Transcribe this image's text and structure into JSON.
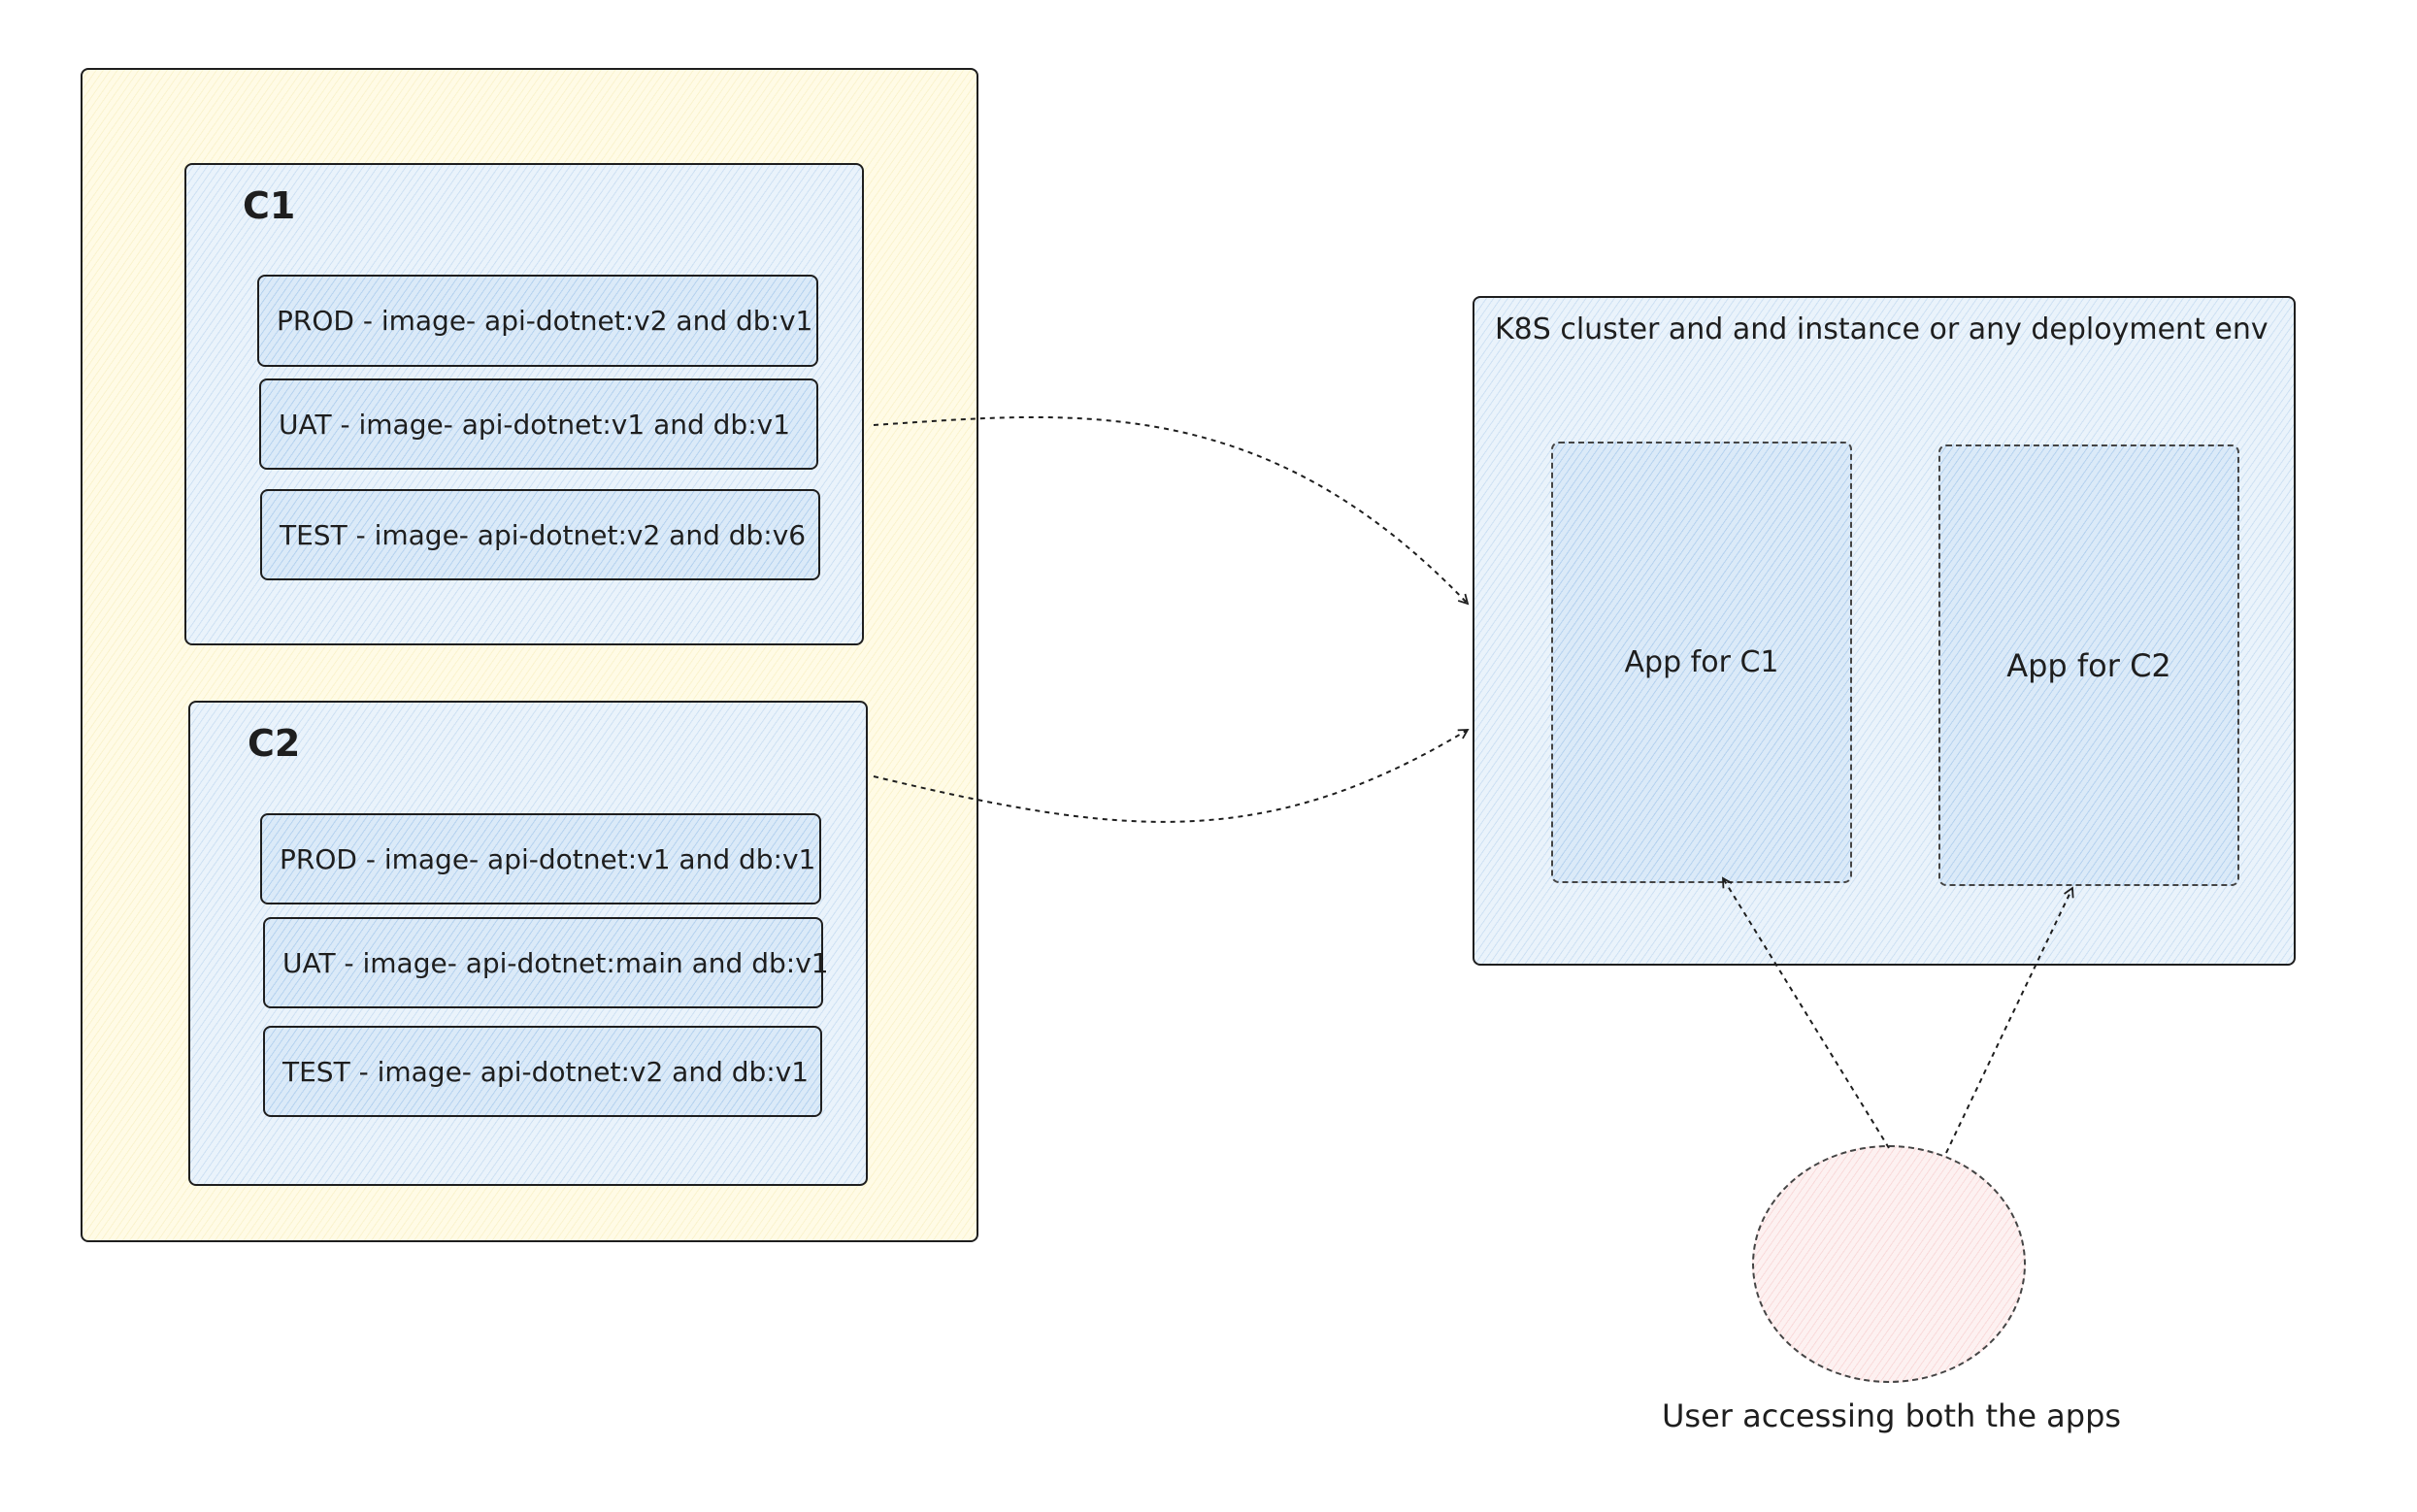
{
  "colors": {
    "stroke": "#1e1e1e",
    "outer_fill": "#fff9db",
    "box_fill": "#d0e7f8",
    "user_fill": "#fce4e4"
  },
  "groups": [
    {
      "title": "C1",
      "environments": [
        "PROD - image- api-dotnet:v2 and db:v1",
        "UAT - image- api-dotnet:v1 and db:v1",
        "TEST - image- api-dotnet:v2 and db:v6"
      ]
    },
    {
      "title": "C2",
      "environments": [
        "PROD - image- api-dotnet:v1 and db:v1",
        "UAT - image- api-dotnet:main and db:v1",
        "TEST - image- api-dotnet:v2 and db:v1"
      ]
    }
  ],
  "cluster": {
    "title": "K8S cluster and and instance or any deployment env",
    "apps": [
      "App for C1",
      "App for C2"
    ]
  },
  "user": {
    "label": "User accessing both the apps"
  }
}
